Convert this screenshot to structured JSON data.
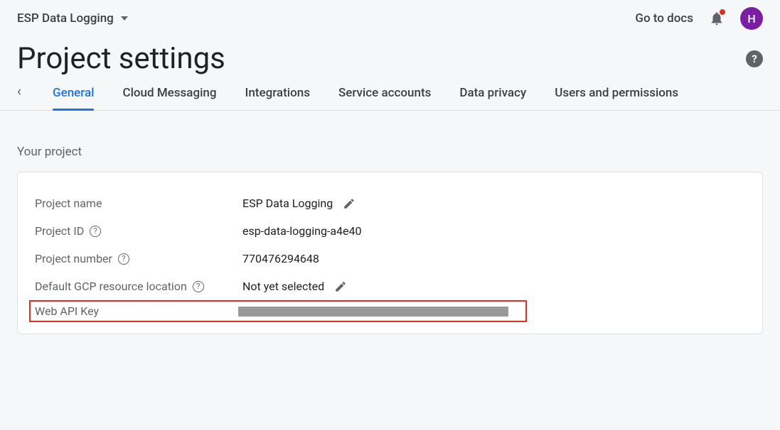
{
  "header": {
    "project_name": "ESP Data Logging",
    "go_to_docs": "Go to docs",
    "avatar_letter": "H"
  },
  "page": {
    "title": "Project settings"
  },
  "tabs": {
    "back_glyph": "‹",
    "items": [
      {
        "label": "General",
        "active": true
      },
      {
        "label": "Cloud Messaging",
        "active": false
      },
      {
        "label": "Integrations",
        "active": false
      },
      {
        "label": "Service accounts",
        "active": false
      },
      {
        "label": "Data privacy",
        "active": false
      },
      {
        "label": "Users and permissions",
        "active": false
      }
    ]
  },
  "section": {
    "label": "Your project"
  },
  "fields": {
    "project_name": {
      "label": "Project name",
      "value": "ESP Data Logging"
    },
    "project_id": {
      "label": "Project ID",
      "value": "esp-data-logging-a4e40"
    },
    "project_number": {
      "label": "Project number",
      "value": "770476294648"
    },
    "gcp_location": {
      "label": "Default GCP resource location",
      "value": "Not yet selected"
    },
    "web_api_key": {
      "label": "Web API Key",
      "value": ""
    }
  },
  "glyphs": {
    "help": "?",
    "info": "?"
  }
}
